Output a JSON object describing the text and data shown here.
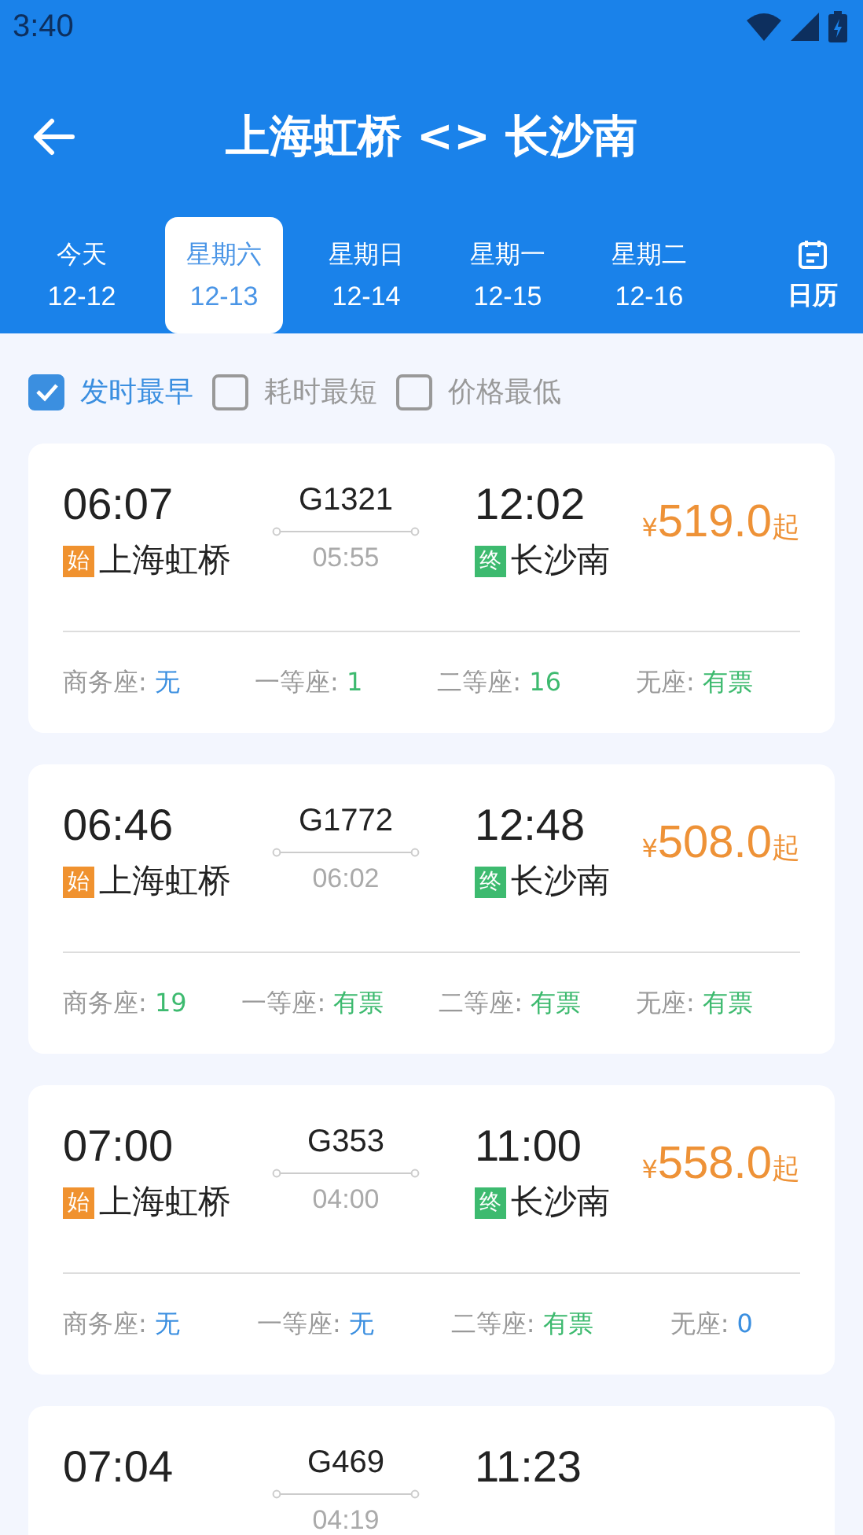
{
  "status_bar": {
    "time": "3:40"
  },
  "header": {
    "title": "上海虹桥 <> 长沙南"
  },
  "date_tabs": [
    {
      "day": "今天",
      "date": "12-12",
      "selected": false
    },
    {
      "day": "星期六",
      "date": "12-13",
      "selected": true
    },
    {
      "day": "星期日",
      "date": "12-14",
      "selected": false
    },
    {
      "day": "星期一",
      "date": "12-15",
      "selected": false
    },
    {
      "day": "星期二",
      "date": "12-16",
      "selected": false
    }
  ],
  "calendar_button": {
    "label": "日历"
  },
  "sort_options": [
    {
      "label": "发时最早",
      "checked": true
    },
    {
      "label": "耗时最短",
      "checked": false
    },
    {
      "label": "价格最低",
      "checked": false
    }
  ],
  "trains": [
    {
      "depart_time": "06:07",
      "depart_badge": "始",
      "depart_station": "上海虹桥",
      "train_no": "G1321",
      "duration": "05:55",
      "arrive_time": "12:02",
      "arrive_badge": "终",
      "arrive_station": "长沙南",
      "currency": "¥",
      "price": "519.0",
      "price_suffix": "起",
      "seats": [
        {
          "label": "商务座:",
          "value": "无",
          "color": "#3b8fe0"
        },
        {
          "label": "一等座:",
          "value": "1",
          "color": "#3dba6f"
        },
        {
          "label": "二等座:",
          "value": "16",
          "color": "#3dba6f"
        },
        {
          "label": "无座:",
          "value": "有票",
          "color": "#3dba6f"
        }
      ]
    },
    {
      "depart_time": "06:46",
      "depart_badge": "始",
      "depart_station": "上海虹桥",
      "train_no": "G1772",
      "duration": "06:02",
      "arrive_time": "12:48",
      "arrive_badge": "终",
      "arrive_station": "长沙南",
      "currency": "¥",
      "price": "508.0",
      "price_suffix": "起",
      "seats": [
        {
          "label": "商务座:",
          "value": "19",
          "color": "#3dba6f"
        },
        {
          "label": "一等座:",
          "value": "有票",
          "color": "#3dba6f"
        },
        {
          "label": "二等座:",
          "value": "有票",
          "color": "#3dba6f"
        },
        {
          "label": "无座:",
          "value": "有票",
          "color": "#3dba6f"
        }
      ]
    },
    {
      "depart_time": "07:00",
      "depart_badge": "始",
      "depart_station": "上海虹桥",
      "train_no": "G353",
      "duration": "04:00",
      "arrive_time": "11:00",
      "arrive_badge": "终",
      "arrive_station": "长沙南",
      "currency": "¥",
      "price": "558.0",
      "price_suffix": "起",
      "seats": [
        {
          "label": "商务座:",
          "value": "无",
          "color": "#3b8fe0"
        },
        {
          "label": "一等座:",
          "value": "无",
          "color": "#3b8fe0"
        },
        {
          "label": "二等座:",
          "value": "有票",
          "color": "#3dba6f"
        },
        {
          "label": "无座:",
          "value": "0",
          "color": "#3b8fe0"
        }
      ]
    },
    {
      "depart_time": "07:04",
      "train_no": "G469",
      "duration": "04:19",
      "arrive_time": "11:23"
    }
  ]
}
